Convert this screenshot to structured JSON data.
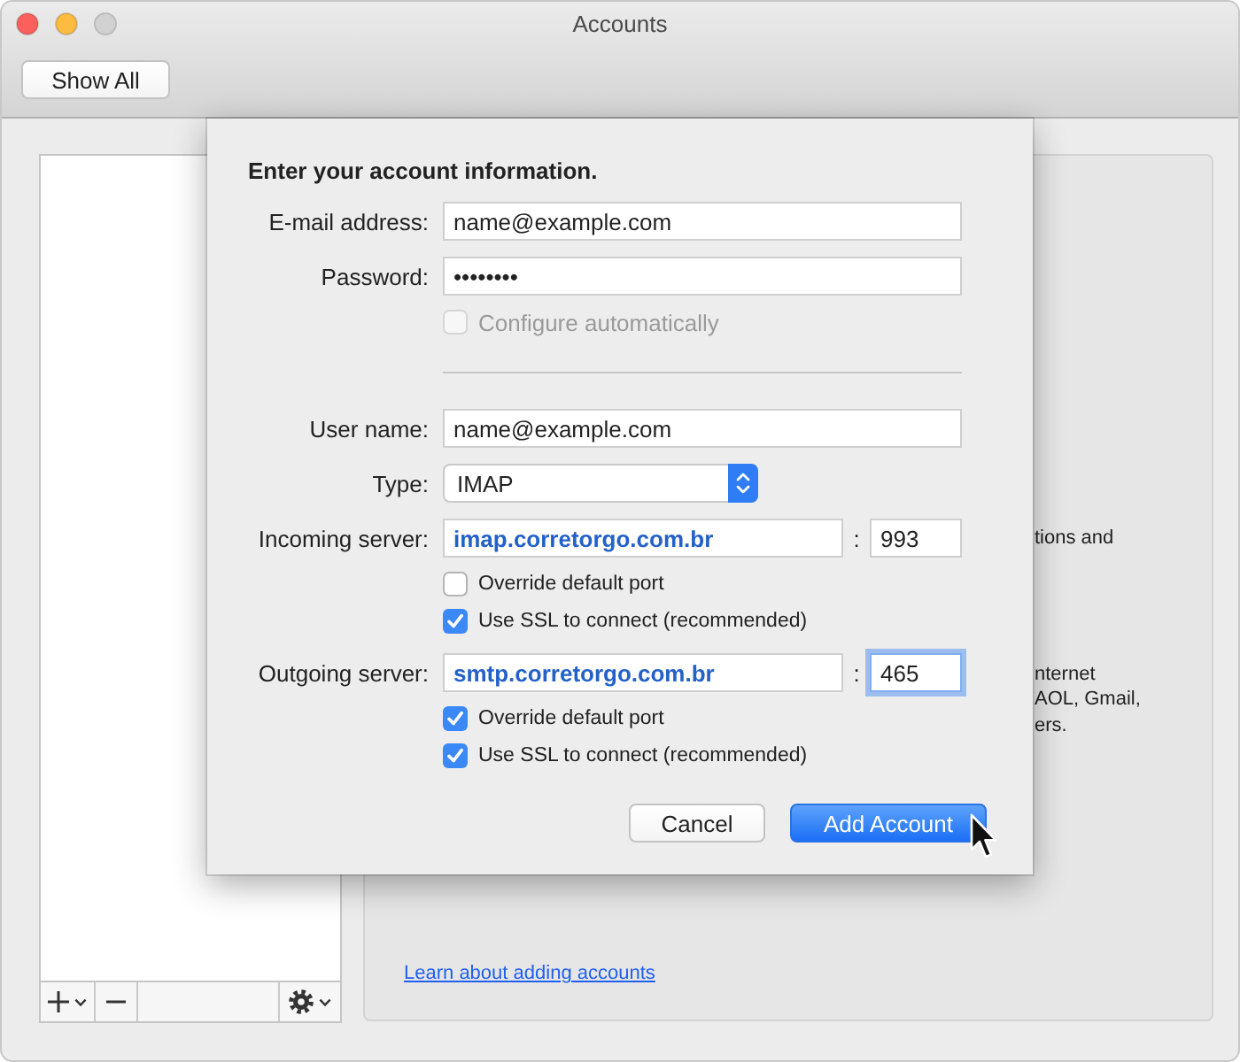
{
  "window": {
    "title": "Accounts",
    "controls": [
      {
        "kind": "close",
        "disabled": false
      },
      {
        "kind": "minimize",
        "disabled": false
      },
      {
        "kind": "zoom",
        "disabled": true
      }
    ]
  },
  "toolbar": {
    "buttons": [
      "Show All"
    ]
  },
  "info_panel": {
    "paragraphs": [
      [
        "tions and"
      ],
      [
        "nternet",
        "AOL, Gmail,",
        "ers."
      ]
    ],
    "link": "Learn about adding accounts"
  },
  "sheet": {
    "heading": "Enter your account information.",
    "rows": [
      {
        "kind": "text",
        "label": "E-mail address:",
        "value": "name@example.com"
      },
      {
        "kind": "password",
        "label": "Password:",
        "value": "••••••••"
      },
      {
        "kind": "checkbox",
        "label": "Configure automatically",
        "checked": false,
        "disabled": true
      },
      {
        "kind": "separator"
      },
      {
        "kind": "text",
        "label": "User name:",
        "value": "name@example.com"
      },
      {
        "kind": "select",
        "label": "Type:",
        "value": "IMAP"
      },
      {
        "kind": "server",
        "label": "Incoming server:",
        "value": "imap.corretorgo.com.br",
        "colon": ":",
        "port": "993",
        "focused": false
      },
      {
        "kind": "option",
        "label": "Override default port",
        "checked": false,
        "disabled": false
      },
      {
        "kind": "option",
        "label": "Use SSL to connect (recommended)",
        "checked": true,
        "disabled": false
      },
      {
        "kind": "server",
        "label": "Outgoing server:",
        "value": "smtp.corretorgo.com.br",
        "colon": ":",
        "port": "465",
        "focused": true
      },
      {
        "kind": "option",
        "label": "Override default port",
        "checked": true,
        "disabled": false
      },
      {
        "kind": "option",
        "label": "Use SSL to connect (recommended)",
        "checked": true,
        "disabled": false
      }
    ],
    "buttons": [
      {
        "label": "Cancel",
        "default": false
      },
      {
        "label": "Add Account",
        "default": true
      }
    ]
  }
}
